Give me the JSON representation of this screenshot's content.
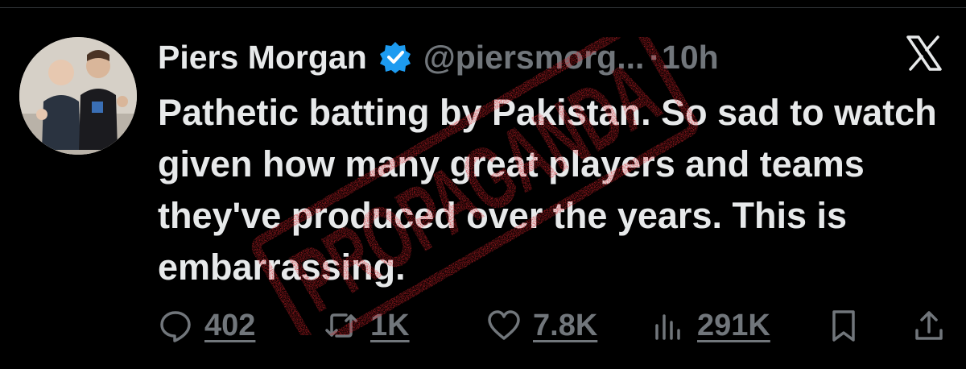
{
  "tweet": {
    "author_name": "Piers Morgan",
    "handle": "@piersmorg...",
    "separator": "·",
    "time": "10h",
    "text": "Pathetic batting by Pakistan. So sad to watch given how many great players and teams they've produced over the years. This is embarrassing."
  },
  "actions": {
    "replies": "402",
    "reposts": "1K",
    "likes": "7.8K",
    "views": "291K"
  },
  "stamp": {
    "text": "PROPAGANDA",
    "color": "#d8232a"
  },
  "colors": {
    "background": "#000000",
    "text": "#e7e9ea",
    "muted": "#71767b",
    "verified": "#1d9bf0"
  }
}
